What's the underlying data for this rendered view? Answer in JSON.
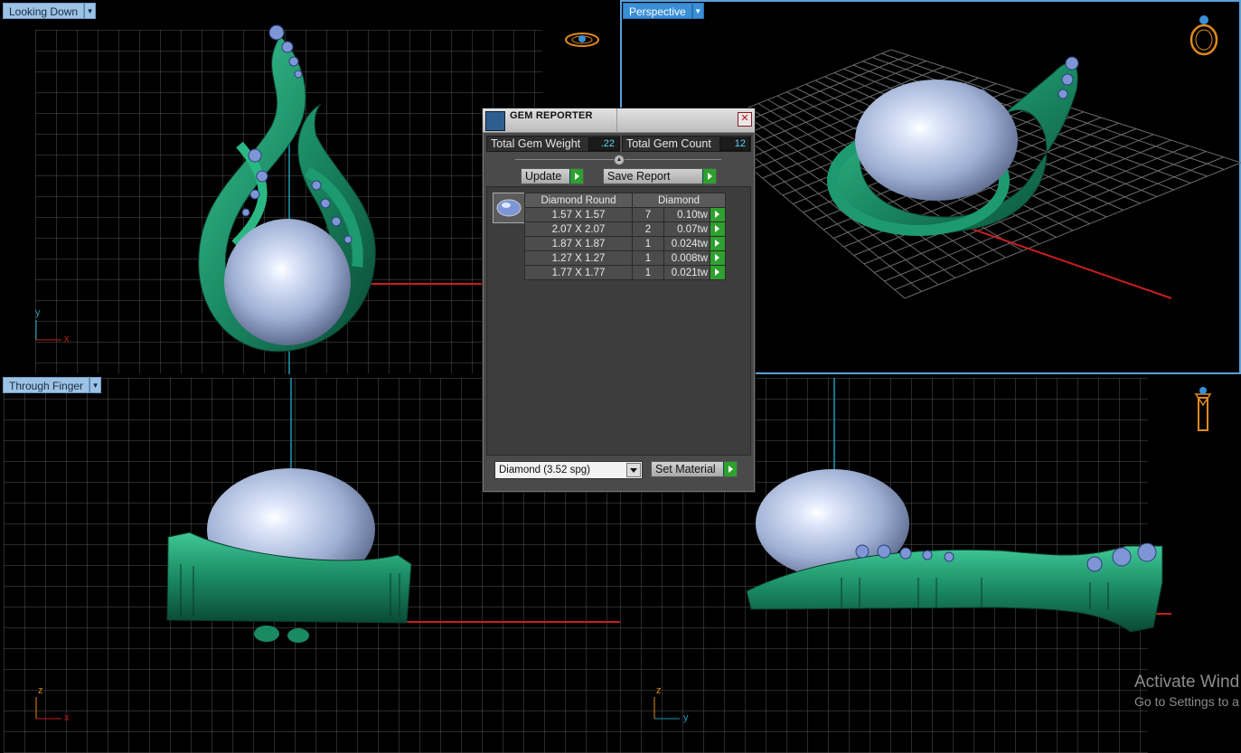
{
  "viewports": {
    "top_left": {
      "label": "Looking Down"
    },
    "top_right": {
      "label": "Perspective"
    },
    "bottom_left": {
      "label": "Through Finger"
    }
  },
  "axes": {
    "top_left": {
      "h": "x",
      "v": "y"
    },
    "bottom_left": {
      "h": "x",
      "v": "z"
    },
    "bottom_right": {
      "h": "y",
      "v": "z"
    }
  },
  "gem_reporter": {
    "title": "GEM REPORTER",
    "total_weight_label": "Total Gem Weight",
    "total_weight_value": ".22",
    "total_count_label": "Total Gem Count",
    "total_count_value": "12",
    "update_label": "Update",
    "save_report_label": "Save Report",
    "table_headers": [
      "Diamond Round",
      "Diamond"
    ],
    "rows": [
      {
        "size": "1.57 X 1.57",
        "count": "7",
        "weight": "0.10tw"
      },
      {
        "size": "2.07 X 2.07",
        "count": "2",
        "weight": "0.07tw"
      },
      {
        "size": "1.87 X 1.87",
        "count": "1",
        "weight": "0.024tw"
      },
      {
        "size": "1.27 X 1.27",
        "count": "1",
        "weight": "0.008tw"
      },
      {
        "size": "1.77 X 1.77",
        "count": "1",
        "weight": "0.021tw"
      }
    ],
    "material_select": "Diamond    (3.52 spg)",
    "set_material_label": "Set Material"
  },
  "watermark": {
    "line1": "Activate Wind",
    "line2": "Go to Settings to a"
  },
  "colors": {
    "metal_green": "#1f8f6a",
    "pearl": "#aebfe0",
    "grid": "#5a5a5a",
    "axis_red": "#c81e1e",
    "axis_cyan": "#1e9ab4",
    "viewport_label": "#9cc3e4",
    "active_label": "#3a8fd6"
  }
}
